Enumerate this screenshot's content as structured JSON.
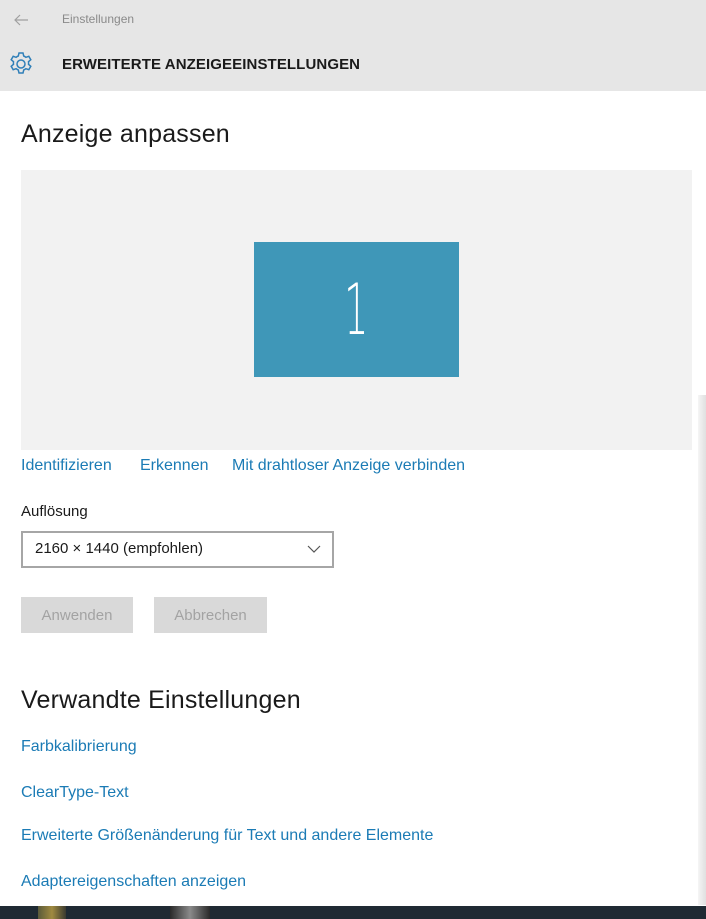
{
  "window": {
    "app_title": "Einstellungen",
    "back_icon": "back-arrow-icon",
    "section_icon": "gear-icon",
    "section_title": "ERWEITERTE ANZEIGEEINSTELLUNGEN"
  },
  "display": {
    "heading": "Anzeige anpassen",
    "monitor_number": "1",
    "monitor_color": "#3f97b8",
    "links": {
      "identify": "Identifizieren",
      "detect": "Erkennen",
      "wireless": "Mit drahtloser Anzeige verbinden"
    },
    "resolution": {
      "label": "Auflösung",
      "selected": "2160 × 1440 (empfohlen)"
    },
    "buttons": {
      "apply": "Anwenden",
      "cancel": "Abbrechen"
    }
  },
  "related": {
    "heading": "Verwandte Einstellungen",
    "links": [
      "Farbkalibrierung",
      "ClearType-Text",
      "Erweiterte Größenänderung für Text und andere Elemente",
      "Adaptereigenschaften anzeigen"
    ]
  },
  "colors": {
    "accent": "#1b7bb5",
    "header_bg": "#e6e6e6"
  }
}
